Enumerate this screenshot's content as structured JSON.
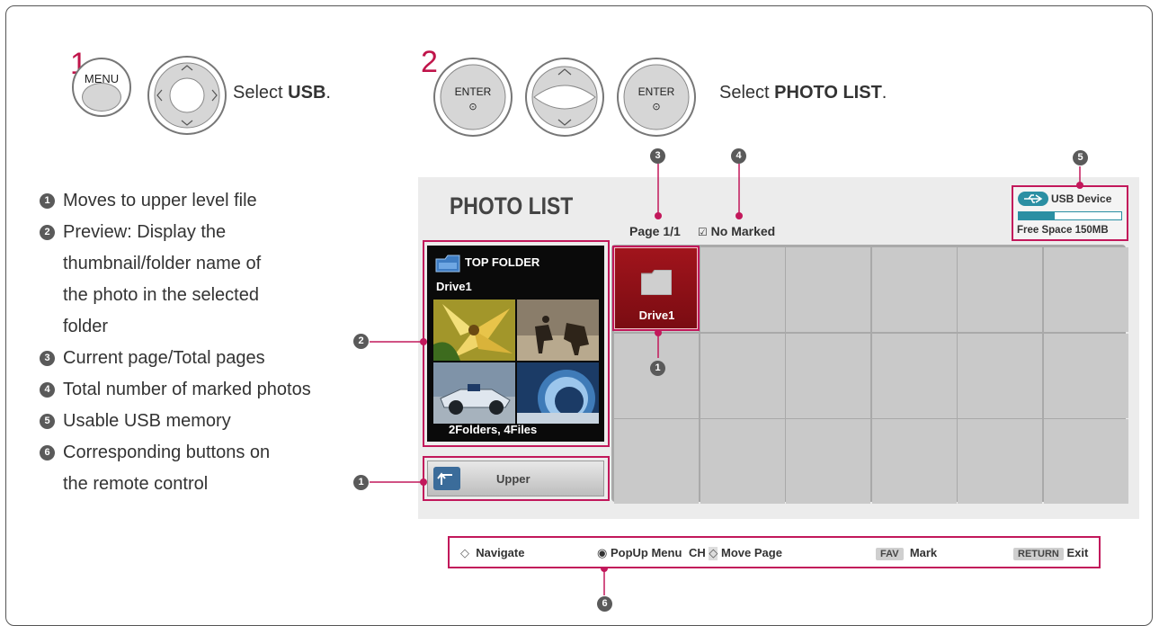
{
  "step1": {
    "number": "1",
    "menu_label": "MENU",
    "instruction_prefix": "Select ",
    "instruction_bold": "USB",
    "instruction_suffix": "."
  },
  "step2": {
    "number": "2",
    "enter_label": "ENTER",
    "enter_symbol": "⊙",
    "instruction_prefix": "Select ",
    "instruction_bold": "PHOTO LIST",
    "instruction_suffix": "."
  },
  "legend": [
    {
      "num": "1",
      "text": "Moves to upper level file"
    },
    {
      "num": "2",
      "text": "Preview: Display the"
    },
    {
      "num": "",
      "text": "thumbnail/folder name of"
    },
    {
      "num": "",
      "text": "the photo in the selected"
    },
    {
      "num": "",
      "text": "folder"
    },
    {
      "num": "3",
      "text": "Current page/Total pages"
    },
    {
      "num": "4",
      "text": "Total number of marked photos"
    },
    {
      "num": "5",
      "text": "Usable USB memory"
    },
    {
      "num": "6",
      "text": "Corresponding buttons on"
    },
    {
      "num": "",
      "text": "the remote control"
    }
  ],
  "screen": {
    "title": "PHOTO LIST",
    "page": "Page 1/1",
    "marked_icon": "☑",
    "marked": "No Marked",
    "usb_device": "USB Device",
    "free_space": "Free Space 150MB",
    "usb_usage_fraction": 0.35,
    "preview_folder_title": "TOP FOLDER",
    "preview_drive": "Drive1",
    "preview_count": "2Folders, 4Files",
    "upper_label": "Upper",
    "selected_item_label": "Drive1"
  },
  "callouts": {
    "c1": "1",
    "c2": "2",
    "c3": "3",
    "c4": "4",
    "c5": "5",
    "c6": "6"
  },
  "bottom_bar": {
    "navigate_icon": "◇",
    "navigate": "Navigate",
    "popup_icon": "◉",
    "popup": "PopUp Menu",
    "ch": "CH",
    "ch_icon": "◇",
    "move_page": "Move Page",
    "fav_key": "FAV",
    "mark": "Mark",
    "return_key": "RETURN",
    "exit": "Exit"
  },
  "colors": {
    "accent": "#c2185b",
    "selected": "#9c1018",
    "usb_icon": "#2b8fa3"
  }
}
